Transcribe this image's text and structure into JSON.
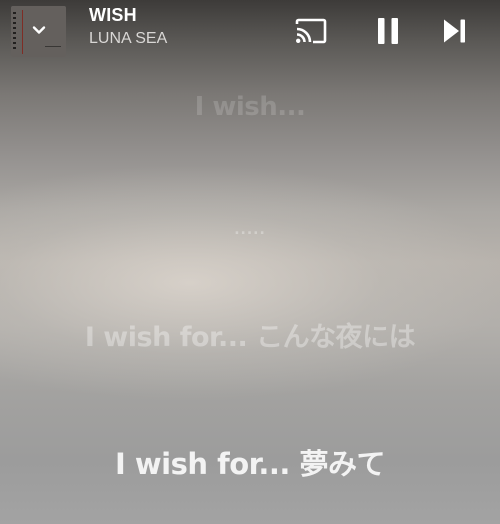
{
  "player": {
    "track_title": "WISH",
    "artist": "LUNA SEA",
    "icons": {
      "collapse": "chevron-down-icon",
      "cast": "cast-icon",
      "pause": "pause-icon",
      "next": "skip-next-icon"
    }
  },
  "lyrics": {
    "lines": [
      "I wish...",
      ".....",
      "I wish for... こんな夜には",
      "I wish for... 夢みて"
    ],
    "active_index": 3
  }
}
